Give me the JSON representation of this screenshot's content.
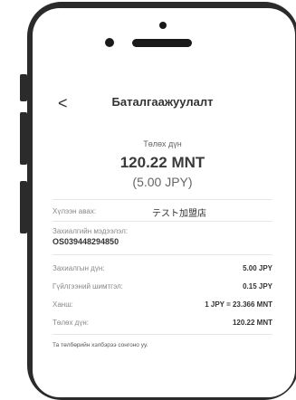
{
  "header": {
    "back_glyph": "<",
    "title": "Баталгаажуулалт"
  },
  "payment": {
    "amount_label": "Төлөх дүн",
    "amount_mnt": "120.22 MNT",
    "amount_jpy": "(5.00 JPY)"
  },
  "merchant": {
    "label": "Хүлээн авах:",
    "value": "テスト加盟店"
  },
  "order": {
    "label": "Захиалгийн мэдээлэл:",
    "value": "OS039448294850"
  },
  "details": [
    {
      "label": "Захиалгын дүн:",
      "value": "5.00 JPY"
    },
    {
      "label": "Гүйлгээний шимтгэл:",
      "value": "0.15 JPY"
    },
    {
      "label": "Ханш:",
      "value": "1 JPY = 23.366 MNT"
    },
    {
      "label": "Төлөх дүн:",
      "value": "120.22 MNT"
    }
  ],
  "consent_text": "Та төлбөрийн хэлбэрээ сонгоно уу."
}
